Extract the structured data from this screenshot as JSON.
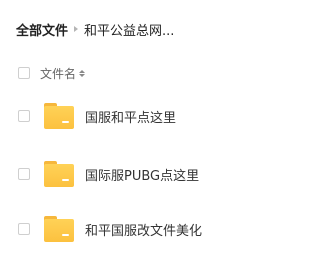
{
  "breadcrumb": {
    "root": "全部文件",
    "current": "和平公益总网..."
  },
  "list_header": {
    "column_label": "文件名",
    "sort_icon": "sort-icon"
  },
  "files": [
    {
      "name": "国服和平点这里",
      "icon": "folder-icon"
    },
    {
      "name": "国际服PUBG点这里",
      "icon": "folder-icon"
    },
    {
      "name": "和平国服改文件美化",
      "icon": "folder-icon"
    }
  ]
}
